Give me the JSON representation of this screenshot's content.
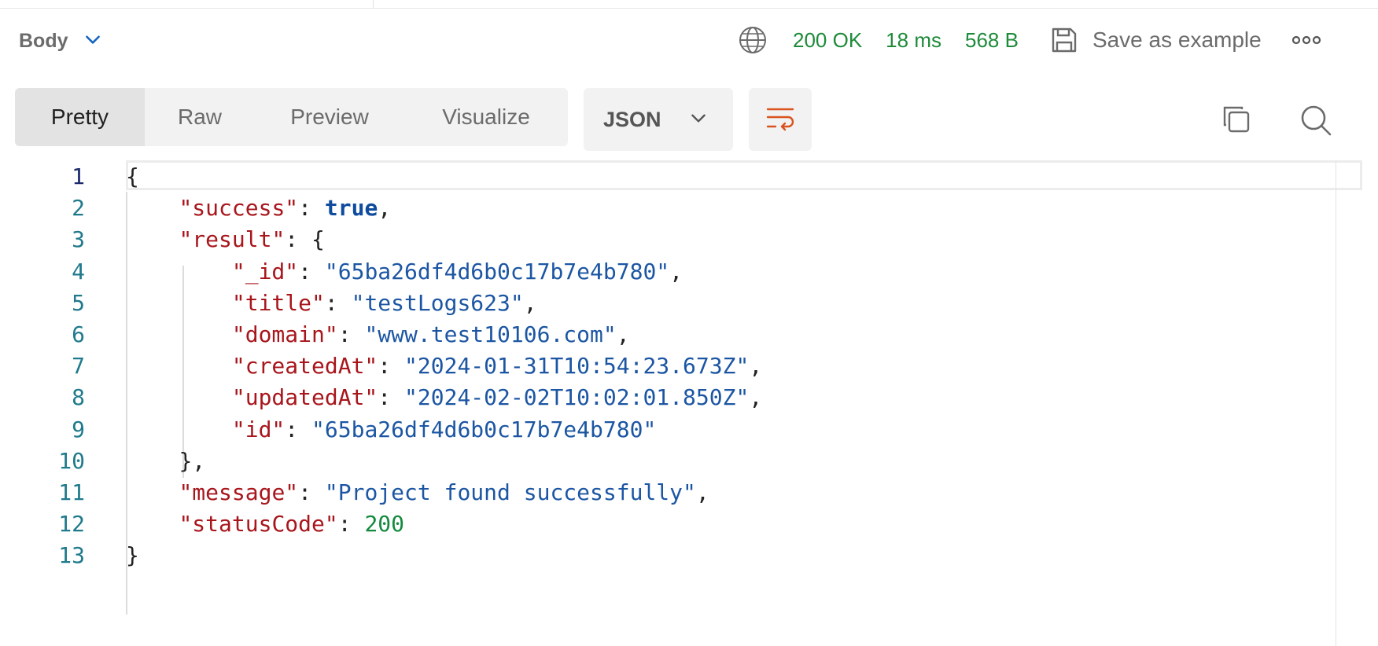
{
  "header": {
    "body_label": "Body",
    "status": "200 OK",
    "time": "18 ms",
    "size": "568 B",
    "save_label": "Save as example",
    "status_color": "#1e8b3a"
  },
  "toolbar": {
    "tabs": [
      "Pretty",
      "Raw",
      "Preview",
      "Visualize"
    ],
    "active_tab": "Pretty",
    "format": "JSON",
    "icons": [
      "chevron-down-icon",
      "globe-icon",
      "save-icon",
      "more-icon",
      "wrap-lines-icon",
      "copy-icon",
      "search-icon"
    ]
  },
  "editor": {
    "line_numbers": [
      "1",
      "2",
      "3",
      "4",
      "5",
      "6",
      "7",
      "8",
      "9",
      "10",
      "11",
      "12",
      "13"
    ],
    "lines": [
      {
        "indent": "",
        "parts": [
          [
            "p",
            "{"
          ]
        ]
      },
      {
        "indent": "    ",
        "parts": [
          [
            "k",
            "\"success\""
          ],
          [
            "p",
            ": "
          ],
          [
            "b",
            "true"
          ],
          [
            "p",
            ","
          ]
        ]
      },
      {
        "indent": "    ",
        "parts": [
          [
            "k",
            "\"result\""
          ],
          [
            "p",
            ": {"
          ]
        ]
      },
      {
        "indent": "        ",
        "parts": [
          [
            "k",
            "\"_id\""
          ],
          [
            "p",
            ": "
          ],
          [
            "s",
            "\"65ba26df4d6b0c17b7e4b780\""
          ],
          [
            "p",
            ","
          ]
        ]
      },
      {
        "indent": "        ",
        "parts": [
          [
            "k",
            "\"title\""
          ],
          [
            "p",
            ": "
          ],
          [
            "s",
            "\"testLogs623\""
          ],
          [
            "p",
            ","
          ]
        ]
      },
      {
        "indent": "        ",
        "parts": [
          [
            "k",
            "\"domain\""
          ],
          [
            "p",
            ": "
          ],
          [
            "s",
            "\"www.test10106.com\""
          ],
          [
            "p",
            ","
          ]
        ]
      },
      {
        "indent": "        ",
        "parts": [
          [
            "k",
            "\"createdAt\""
          ],
          [
            "p",
            ": "
          ],
          [
            "s",
            "\"2024-01-31T10:54:23.673Z\""
          ],
          [
            "p",
            ","
          ]
        ]
      },
      {
        "indent": "        ",
        "parts": [
          [
            "k",
            "\"updatedAt\""
          ],
          [
            "p",
            ": "
          ],
          [
            "s",
            "\"2024-02-02T10:02:01.850Z\""
          ],
          [
            "p",
            ","
          ]
        ]
      },
      {
        "indent": "        ",
        "parts": [
          [
            "k",
            "\"id\""
          ],
          [
            "p",
            ": "
          ],
          [
            "s",
            "\"65ba26df4d6b0c17b7e4b780\""
          ]
        ]
      },
      {
        "indent": "    ",
        "parts": [
          [
            "p",
            "},"
          ]
        ]
      },
      {
        "indent": "    ",
        "parts": [
          [
            "k",
            "\"message\""
          ],
          [
            "p",
            ": "
          ],
          [
            "s",
            "\"Project found successfully\""
          ],
          [
            "p",
            ","
          ]
        ]
      },
      {
        "indent": "    ",
        "parts": [
          [
            "k",
            "\"statusCode\""
          ],
          [
            "p",
            ": "
          ],
          [
            "n",
            "200"
          ]
        ]
      },
      {
        "indent": "",
        "parts": [
          [
            "p",
            "}"
          ]
        ]
      }
    ]
  }
}
